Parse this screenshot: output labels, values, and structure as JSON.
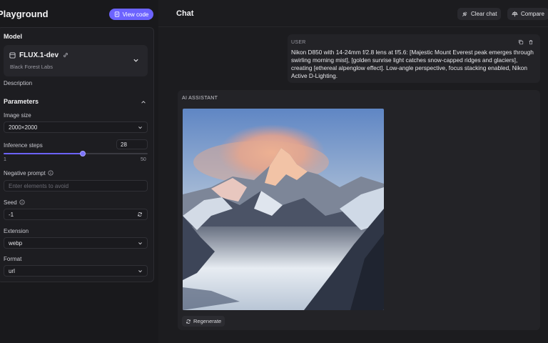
{
  "sidebar": {
    "title": "Playground",
    "view_code_label": "View code",
    "model_section_label": "Model",
    "model_name": "FLUX.1-dev",
    "model_org": "Black Forest Labs",
    "description_label": "Description",
    "parameters_label": "Parameters",
    "image_size": {
      "label": "Image size",
      "value": "2000×2000"
    },
    "inference_steps": {
      "label": "Inference steps",
      "value": "28",
      "min": "1",
      "max": "50",
      "level": 28
    },
    "negative_prompt": {
      "label": "Negative prompt",
      "placeholder": "Enter elements to avoid"
    },
    "seed": {
      "label": "Seed",
      "value": "-1"
    },
    "extension": {
      "label": "Extension",
      "value": "webp"
    },
    "format": {
      "label": "Format",
      "value": "url"
    }
  },
  "chat": {
    "title": "Chat",
    "clear_chat_label": "Clear chat",
    "compare_label": "Compare",
    "user_label": "USER",
    "user_message": "Nikon D850 with 14-24mm f/2.8 lens at f/5.6: [Majestic Mount Everest peak emerges through swirling morning mist], [golden sunrise light catches snow-capped ridges and glaciers], creating [ethereal alpenglow effect]. Low-angle perspective, focus stacking enabled, Nikon Active D-Lighting.",
    "assistant_label": "AI ASSISTANT",
    "regenerate_label": "Regenerate"
  },
  "colors": {
    "accent": "#6c63ff",
    "background": "#1c1c1f",
    "panel": "#232327"
  },
  "icons": [
    "code-icon",
    "model-icon",
    "link-icon",
    "chevron-down-icon",
    "chevron-up-icon",
    "info-icon",
    "refresh-icon",
    "clear-chat-icon",
    "compare-icon",
    "copy-icon",
    "trash-icon",
    "regenerate-icon"
  ]
}
